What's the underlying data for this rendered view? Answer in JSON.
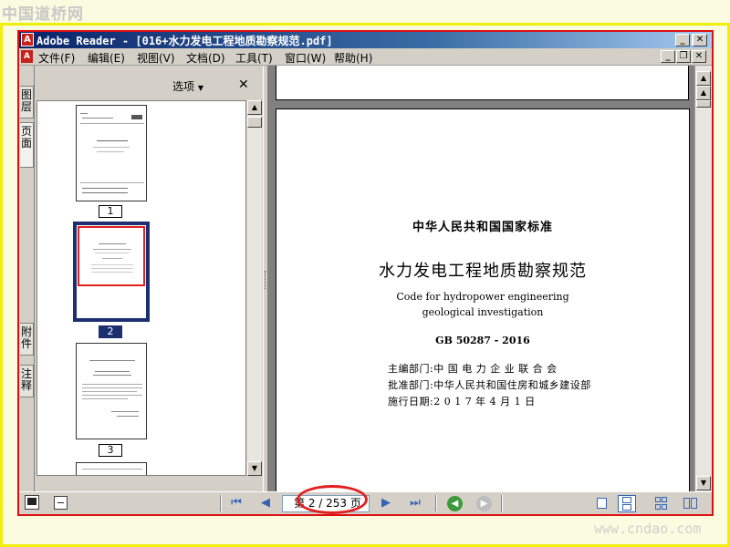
{
  "watermark": {
    "top": "中国道桥网",
    "bottom": "www.cndao.com"
  },
  "window": {
    "title": "Adobe Reader - [016+水力发电工程地质勘察规范.pdf]",
    "app_icon": "adobe-reader-icon",
    "caption_buttons": [
      "minimize",
      "maximize",
      "close"
    ]
  },
  "menu": {
    "items": [
      "文件(F)",
      "编辑(E)",
      "视图(V)",
      "文档(D)",
      "工具(T)",
      "窗口(W)",
      "帮助(H)"
    ]
  },
  "side_tabs": {
    "layers": "图层",
    "pages": "页面",
    "attachments": "附件",
    "comments": "注释"
  },
  "nav_panel": {
    "options_label": "选项",
    "close_glyph": "✕",
    "thumbnails": [
      {
        "page": "1",
        "selected": false
      },
      {
        "page": "2",
        "selected": true
      },
      {
        "page": "3",
        "selected": false
      }
    ]
  },
  "document": {
    "heading": "中华人民共和国国家标准",
    "title_cn": "水力发电工程地质勘察规范",
    "title_en_1": "Code for hydropower engineering",
    "title_en_2": "geological investigation",
    "code": "GB 50287 - 2016",
    "editor": "主编部门:中 国 电 力 企 业 联 合 会",
    "approver": "批准部门:中华人民共和国住房和城乡建设部",
    "effective": "施行日期:2 0 1 7 年 4 月 1 日"
  },
  "status": {
    "page_display": "第 2 / 253 页",
    "current_page": 2,
    "total_pages": 253
  },
  "colors": {
    "highlight": "#e32020",
    "frame_red": "#dd1111",
    "frame_yellow": "#f0ee0a",
    "titlebar_start": "#0a246a",
    "titlebar_end": "#a6caf0",
    "selection": "#0a246a"
  }
}
